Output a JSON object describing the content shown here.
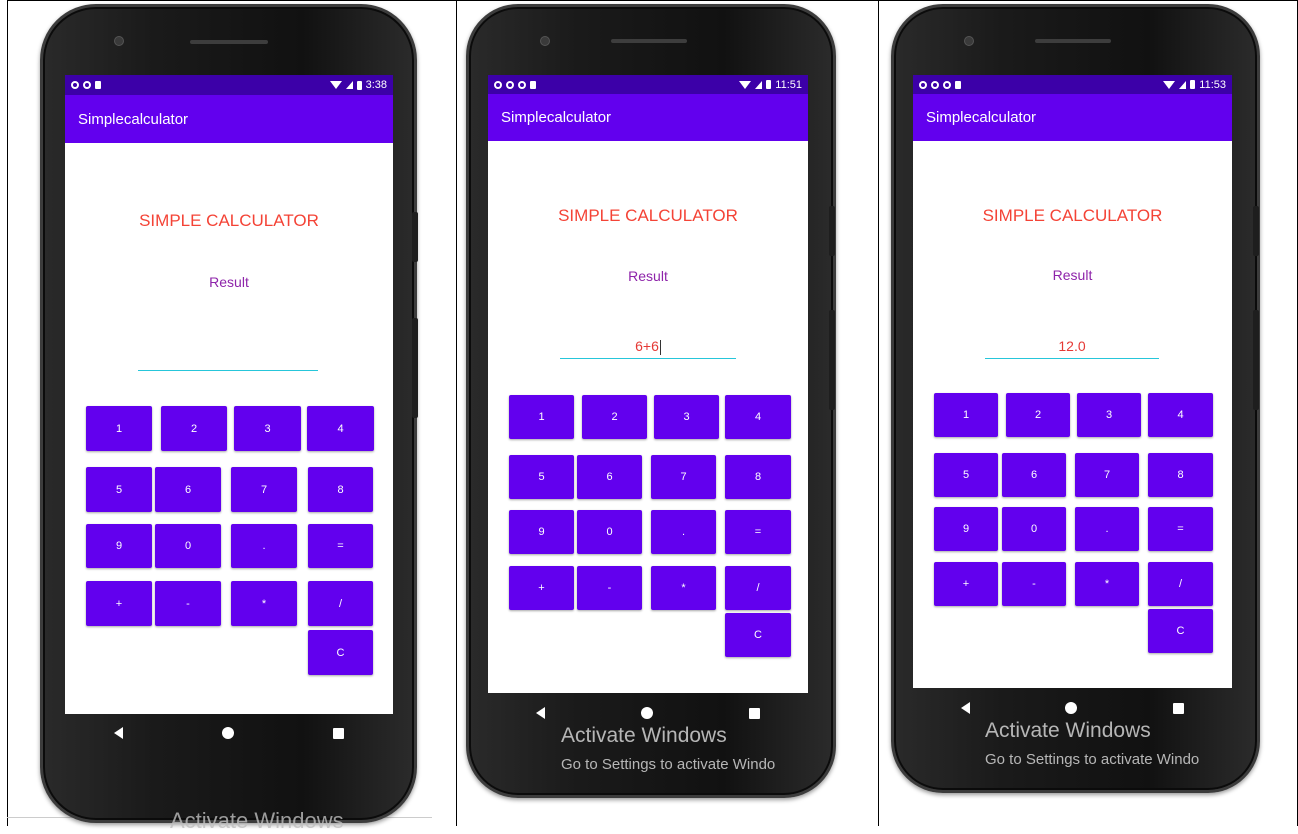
{
  "phones": [
    {
      "status_time": "3:38",
      "app_title": "Simplecalculator",
      "heading": "SIMPLE CALCULATOR",
      "result_label": "Result",
      "input_value": "",
      "keys": [
        "1",
        "2",
        "3",
        "4",
        "5",
        "6",
        "7",
        "8",
        "9",
        "0",
        ".",
        "=",
        "+",
        "-",
        "*",
        "/",
        "C"
      ]
    },
    {
      "status_time": "11:51",
      "app_title": "Simplecalculator",
      "heading": "SIMPLE CALCULATOR",
      "result_label": "Result",
      "input_value": "6+6",
      "keys": [
        "1",
        "2",
        "3",
        "4",
        "5",
        "6",
        "7",
        "8",
        "9",
        "0",
        ".",
        "=",
        "+",
        "-",
        "*",
        "/",
        "C"
      ],
      "watermark_title": "Activate Windows",
      "watermark_sub": "Go to Settings to activate Windo"
    },
    {
      "status_time": "11:53",
      "app_title": "Simplecalculator",
      "heading": "SIMPLE CALCULATOR",
      "result_label": "Result",
      "input_value": "12.0",
      "keys": [
        "1",
        "2",
        "3",
        "4",
        "5",
        "6",
        "7",
        "8",
        "9",
        "0",
        ".",
        "=",
        "+",
        "-",
        "*",
        "/",
        "C"
      ],
      "watermark_title": "Activate Windows",
      "watermark_sub": "Go to Settings to activate Windo"
    }
  ],
  "bottom_watermark": "Activate Windows",
  "colors": {
    "app_bar": "#6200ee",
    "status_bar": "#3c00a8",
    "heading": "#f44336",
    "result": "#8e24aa",
    "underline": "#26c6da"
  }
}
